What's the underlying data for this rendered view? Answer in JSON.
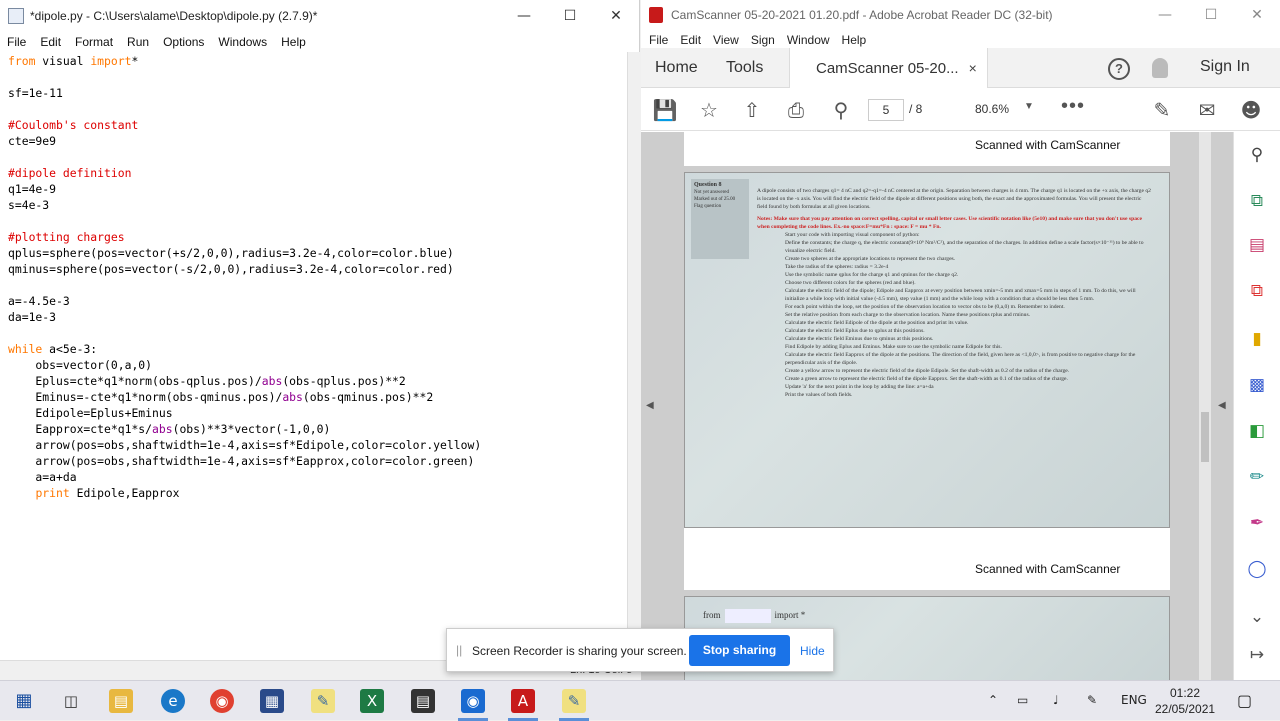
{
  "idle": {
    "title": "*dipole.py - C:\\Users\\alame\\Desktop\\dipole.py (2.7.9)*",
    "menu": [
      "File",
      "Edit",
      "Format",
      "Run",
      "Options",
      "Windows",
      "Help"
    ],
    "status": "Ln: 19  Col: 5"
  },
  "acrobat": {
    "title": "CamScanner 05-20-2021 01.20.pdf - Adobe Acrobat Reader DC (32-bit)",
    "menu": [
      "File",
      "Edit",
      "View",
      "Sign",
      "Window",
      "Help"
    ],
    "tabs": {
      "home": "Home",
      "tools": "Tools",
      "doc": "CamScanner 05-20...",
      "close": "×"
    },
    "help": "?",
    "sign_in": "Sign In",
    "page_current": "5",
    "page_total": "/  8",
    "zoom": "80.6%",
    "scan_label_1": "Scanned with CamScanner",
    "scan_label_2": "Scanned with CamScanner",
    "photo": {
      "side": [
        "Question 8",
        "Not yet answered",
        "Marked out of 25.00",
        "Flag question"
      ],
      "intro": "A dipole consists of two charges q1= 4 nC and q2=-q1=-4 nC centered at the origin. Separation between charges is 4 mm. The charge q1 is located on the +x axis, the charge q2 is located on the -x axis. You will find the electric field of the dipole at different positions using both, the exact and the approximated formulas. You will present the electric field found by both formulas at all given locations.",
      "notes": "Notes: Make sure that you pay attention on correct spelling, capital or small letter cases. Use scientific notation like (5e10) and make sure that you don't use space when completing the code lines. Ex.-no space:F=mu*Fn : space: F = mu * Fn.",
      "steps": [
        "Start your code with importing visual component of python:",
        "Define the constants; the charge q, the electric constant(9×10⁹ Nm²/C²), and the separation of the charges. In addition define a scale factor(s×10⁻¹¹) to be able to visualize electric field.",
        "Create two spheres at the appropriate locations to represent the two charges.",
        "Take the radius of the spheres: radius = 3.2e-4",
        "Use the symbolic name qplus for the charge q1 and qminus for the charge q2.",
        "Choose two different colors for the spheres (red and blue).",
        "Calculate the electric field of the dipole; Edipole and Eapprox at every position between xmin=-5 mm and xmax=5 mm in steps of 1 mm. To do this, we will initialize a while loop with initial value (-4.5 mm), step value (1 mm) and the while loop with a condition that a should be less then 5 mm.",
        "For each point within the loop, set the position of the observation location to vector obs to be (0,a,0) m. Remember to indent.",
        "Set the relative position from each charge to the observation location. Name these positions rplus and rminus.",
        "Calculate the electric field Edipole of the dipole at the position and print its value.",
        "Calculate the electric field Eplus due to qplus at this positions.",
        "Calculate the electric field Eminus due to qminus at this positions.",
        "Find Edipole by adding Eplus and Eminus. Make sure to use the symbolic name Edipole for this.",
        "Calculate the electric field Eapprox of the dipole at the positions. The direction of the field, given here as <1,0,0>, is from positive to negative charge for the perpendicular axis of the dipole.",
        "Create a yellow arrow to represent the electric field of the dipole Edipole. Set the shaft-width as 0.2 of the radius of the charge.",
        "Create a green arrow to represent the electric field of the dipole Eapprox. Set the shaft-width as 0.1 of the radius of the charge.",
        "Update 'a' for the next point in the loop by adding the line: a=a+da",
        "Print the values of both fields."
      ]
    },
    "photo2": {
      "from": "from",
      "import": "import *"
    }
  },
  "recorder": {
    "grip": "||",
    "message": "Screen Recorder is sharing your screen.",
    "stop_label": "Stop sharing",
    "hide_label": "Hide"
  },
  "taskbar": {
    "lang": "ENG",
    "time": "01:22",
    "date": "22/05/2021"
  },
  "colors": {
    "keyword": "#ff7700",
    "comment": "#dd0000",
    "builtin": "#900090",
    "stop_button": "#1a73e8",
    "acrobat_red": "#c71a1a"
  }
}
